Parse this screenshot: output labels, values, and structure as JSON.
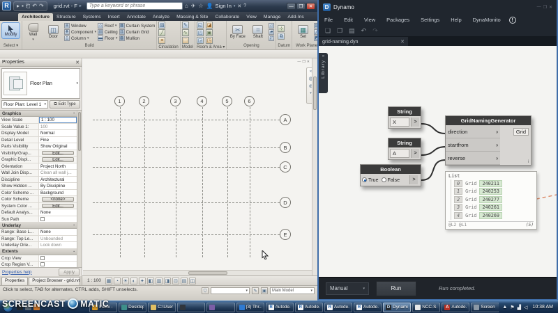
{
  "revit": {
    "titlebar": {
      "title": "grid.rvt - F",
      "search_placeholder": "Type a keyword or phrase",
      "sign_in": "Sign In"
    },
    "tabs": [
      "Architecture",
      "Structure",
      "Systems",
      "Insert",
      "Annotate",
      "Analyze",
      "Massing & Site",
      "Collaborate",
      "View",
      "Manage",
      "Add-Ins"
    ],
    "active_tab": "Architecture",
    "ribbon": {
      "modify": "Modify",
      "select": "Select",
      "build": {
        "label": "Build",
        "wall": "Wall",
        "door": "Door",
        "window": "Window",
        "component": "Component",
        "column": "Column",
        "roof": "Roof",
        "ceiling": "Ceiling",
        "floor": "Floor",
        "curtain_system": "Curtain System",
        "curtain_grid": "Curtain Grid",
        "mullion": "Mullion"
      },
      "circulation": "Circulation",
      "model": "Model",
      "room_area": "Room & Area",
      "opening": {
        "label": "Opening",
        "by_face": "By Face",
        "shaft": "Shaft"
      },
      "datum": "Datum",
      "work_plane": {
        "label": "Work Plane",
        "set": "Set"
      }
    },
    "properties": {
      "title": "Properties",
      "type_name": "Floor Plan",
      "instance": "Floor Plan: Level 1",
      "edit_type": "Edit Type",
      "groups": [
        {
          "name": "Graphics",
          "rows": [
            {
              "l": "View Scale",
              "v": "1 : 100",
              "k": "input"
            },
            {
              "l": "Scale Value    1:",
              "v": "100",
              "gray": true
            },
            {
              "l": "Display Model",
              "v": "Normal"
            },
            {
              "l": "Detail Level",
              "v": "Fine"
            },
            {
              "l": "Parts Visibility",
              "v": "Show Original"
            },
            {
              "l": "Visibility/Grap...",
              "v": "Edit...",
              "k": "button"
            },
            {
              "l": "Graphic Displ...",
              "v": "Edit...",
              "k": "button"
            },
            {
              "l": "Orientation",
              "v": "Project North"
            },
            {
              "l": "Wall Join Disp...",
              "v": "Clean all wall j...",
              "gray": true
            },
            {
              "l": "Discipline",
              "v": "Architectural"
            },
            {
              "l": "Show Hidden ...",
              "v": "By Discipline"
            },
            {
              "l": "Color Scheme ...",
              "v": "Background"
            },
            {
              "l": "Color Scheme",
              "v": "<none>",
              "k": "button"
            },
            {
              "l": "System Color ...",
              "v": "Edit...",
              "k": "button"
            },
            {
              "l": "Default Analys...",
              "v": "None"
            },
            {
              "l": "Sun Path",
              "v": "",
              "k": "checkbox"
            }
          ]
        },
        {
          "name": "Underlay",
          "rows": [
            {
              "l": "Range: Base L...",
              "v": "None"
            },
            {
              "l": "Range: Top Le...",
              "v": "Unbounded",
              "gray": true
            },
            {
              "l": "Underlay Orie...",
              "v": "Look down",
              "gray": true
            }
          ]
        },
        {
          "name": "Extents",
          "rows": [
            {
              "l": "Crop View",
              "v": "",
              "k": "checkbox"
            },
            {
              "l": "Crop Region V...",
              "v": "",
              "k": "checkbox"
            }
          ]
        }
      ],
      "help": "Properties help",
      "apply": "Apply",
      "bottom_tabs": [
        "Properties",
        "Project Browser - grid.rvt"
      ]
    },
    "canvas": {
      "vertical_grids": [
        "1",
        "2",
        "3",
        "4",
        "5",
        "6"
      ],
      "horizontal_grids": [
        "A",
        "B",
        "C",
        "D",
        "E"
      ]
    },
    "viewbar_scale": "1 : 100",
    "status": "Click to select, TAB for alternates, CTRL adds, SHIFT unselects.",
    "main_model": "Main Model"
  },
  "dynamo": {
    "title": "Dynamo",
    "menus": [
      "File",
      "Edit",
      "View",
      "Packages",
      "Settings",
      "Help",
      "DynaMonito"
    ],
    "tab": "grid-naming.dyn",
    "library": "Library",
    "nodes": {
      "string1": {
        "title": "String",
        "value": "X"
      },
      "string2": {
        "title": "String",
        "value": "A"
      },
      "boolean": {
        "title": "Boolean",
        "true_label": "True",
        "false_label": "False"
      },
      "generator": {
        "title": "GridNamingGenerator",
        "inputs": [
          "direction",
          "startfrom",
          "reverse"
        ],
        "output": "Grid"
      }
    },
    "preview": {
      "title": "List",
      "rows": [
        {
          "index": "0",
          "type": "Grid",
          "value": "240211"
        },
        {
          "index": "1",
          "type": "Grid",
          "value": "240253"
        },
        {
          "index": "2",
          "type": "Grid",
          "value": "240277"
        },
        {
          "index": "3",
          "type": "Grid",
          "value": "240261"
        },
        {
          "index": "4",
          "type": "Grid",
          "value": "240269"
        }
      ],
      "levels": "@L2 @L1",
      "count": "(5)"
    },
    "footer": {
      "mode": "Manual",
      "run": "Run",
      "status": "Run completed."
    }
  },
  "taskbar": {
    "watermark": {
      "word1": "SCREENCAST",
      "word2": "MATIC"
    },
    "items": [
      {
        "label": "Inbox - ...",
        "icon": "outlook"
      },
      {
        "label": "Desktop",
        "icon": "desktop"
      },
      {
        "label": "C:\\User...",
        "icon": "folder"
      },
      {
        "label": "",
        "icon": "app1"
      },
      {
        "label": "",
        "icon": "app2"
      },
      {
        "label": "(3) Thr...",
        "icon": "browser"
      },
      {
        "label": "Autode...",
        "icon": "revit"
      },
      {
        "label": "Autode...",
        "icon": "revit"
      },
      {
        "label": "Autode...",
        "icon": "revit"
      },
      {
        "label": "Autode...",
        "icon": "revit"
      },
      {
        "label": "Dynamo",
        "icon": "dynamo",
        "active": true
      },
      {
        "label": "NCC-S-...",
        "icon": "doc"
      },
      {
        "label": "Autode...",
        "icon": "autocad"
      },
      {
        "label": "Screen ...",
        "icon": "screen"
      }
    ],
    "time": "10:38 AM"
  }
}
